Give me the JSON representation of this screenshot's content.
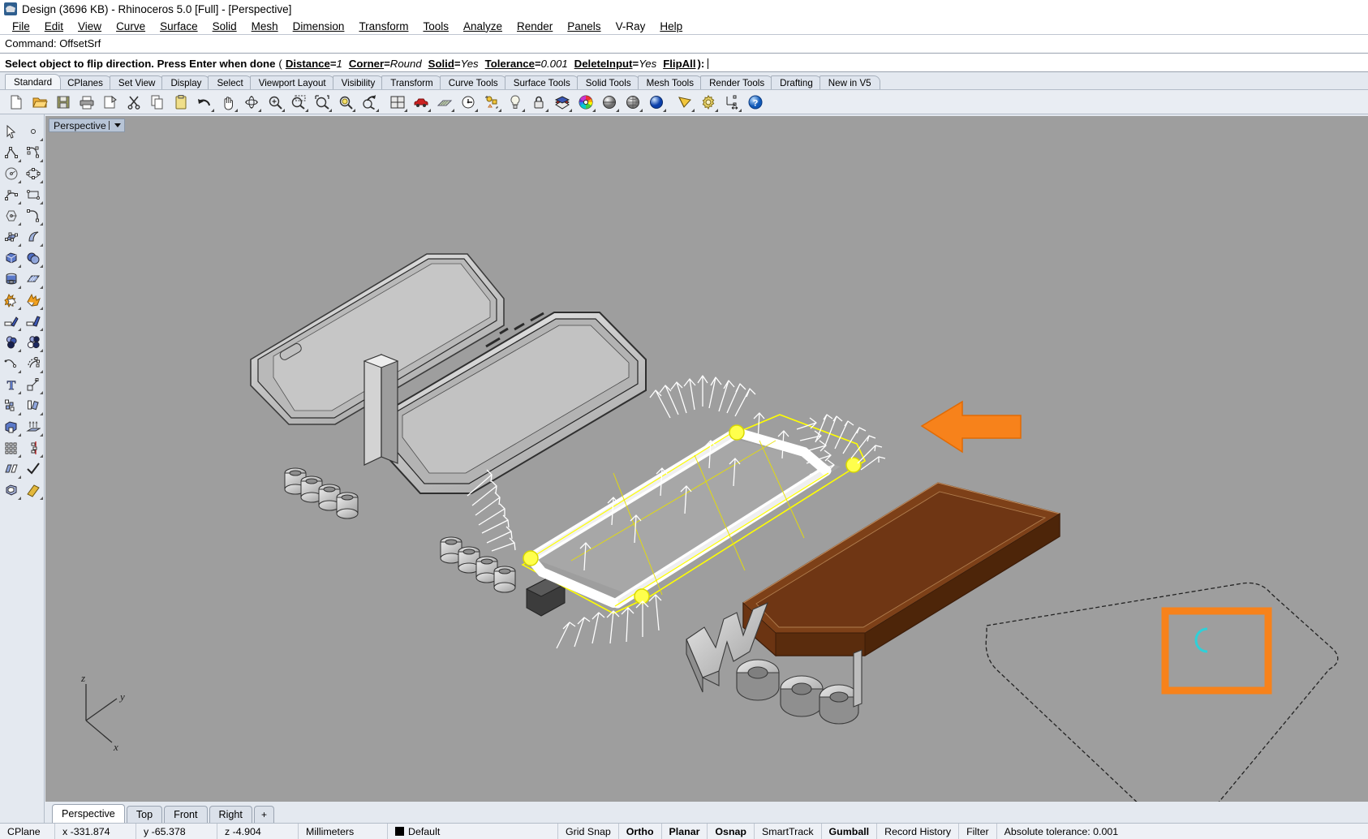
{
  "window": {
    "title": "Design (3696 KB) - Rhinoceros 5.0 [Full] - [Perspective]",
    "app_icon": "rhino-logo-icon"
  },
  "menubar": {
    "items": [
      {
        "label": "File"
      },
      {
        "label": "Edit"
      },
      {
        "label": "View"
      },
      {
        "label": "Curve"
      },
      {
        "label": "Surface"
      },
      {
        "label": "Solid"
      },
      {
        "label": "Mesh"
      },
      {
        "label": "Dimension"
      },
      {
        "label": "Transform"
      },
      {
        "label": "Tools"
      },
      {
        "label": "Analyze"
      },
      {
        "label": "Render"
      },
      {
        "label": "Panels"
      },
      {
        "label": "V-Ray"
      },
      {
        "label": "Help"
      }
    ]
  },
  "command_area": {
    "history": "Command: OffsetSrf",
    "prompt_main": "Select object to flip direction. Press Enter when done",
    "prompt_open": "(",
    "prompt_close": "):",
    "options": [
      {
        "name": "Distance",
        "value": "1"
      },
      {
        "name": "Corner",
        "value": "Round"
      },
      {
        "name": "Solid",
        "value": "Yes"
      },
      {
        "name": "Tolerance",
        "value": "0.001"
      },
      {
        "name": "DeleteInput",
        "value": "Yes"
      },
      {
        "name": "FlipAll",
        "value": ""
      }
    ]
  },
  "toolbar_tabs": {
    "active": "Standard",
    "items": [
      {
        "label": "Standard"
      },
      {
        "label": "CPlanes"
      },
      {
        "label": "Set View"
      },
      {
        "label": "Display"
      },
      {
        "label": "Select"
      },
      {
        "label": "Viewport Layout"
      },
      {
        "label": "Visibility"
      },
      {
        "label": "Transform"
      },
      {
        "label": "Curve Tools"
      },
      {
        "label": "Surface Tools"
      },
      {
        "label": "Solid Tools"
      },
      {
        "label": "Mesh Tools"
      },
      {
        "label": "Render Tools"
      },
      {
        "label": "Drafting"
      },
      {
        "label": "New in V5"
      }
    ]
  },
  "top_toolbar": {
    "buttons": [
      {
        "icon": "new-file-icon",
        "tip": "New"
      },
      {
        "icon": "open-folder-icon",
        "tip": "Open"
      },
      {
        "icon": "save-disk-icon",
        "tip": "Save"
      },
      {
        "icon": "printer-icon",
        "tip": "Print"
      },
      {
        "icon": "copy-to-clipboard-icon",
        "tip": "Copy to clipboard"
      },
      {
        "icon": "scissors-cut-icon",
        "tip": "Cut"
      },
      {
        "icon": "copy-pages-icon",
        "tip": "Copy"
      },
      {
        "icon": "paste-clipboard-icon",
        "tip": "Paste"
      },
      {
        "icon": "undo-arrow-icon",
        "tip": "Undo"
      },
      {
        "icon": "pan-hand-icon",
        "tip": "Pan"
      },
      {
        "icon": "rotate-view-icon",
        "tip": "Rotate view"
      },
      {
        "icon": "zoom-in-magnifier-icon",
        "tip": "Zoom in"
      },
      {
        "icon": "zoom-window-icon",
        "tip": "Zoom window"
      },
      {
        "icon": "zoom-extents-icon",
        "tip": "Zoom extents"
      },
      {
        "icon": "zoom-selected-icon",
        "tip": "Zoom selected"
      },
      {
        "icon": "zoom-dynamic-icon",
        "tip": "Zoom dynamic"
      },
      {
        "icon": "four-viewport-layout-icon",
        "tip": "4 viewports"
      },
      {
        "icon": "red-car-icon",
        "tip": "Shaded viewport"
      },
      {
        "icon": "grid-plane-icon",
        "tip": "Grid"
      },
      {
        "icon": "clock-history-icon",
        "tip": "History"
      },
      {
        "icon": "object-properties-icon",
        "tip": "Properties"
      },
      {
        "icon": "light-bulb-icon",
        "tip": "Lights"
      },
      {
        "icon": "padlock-icon",
        "tip": "Lock object"
      },
      {
        "icon": "layers-icon",
        "tip": "Layers"
      },
      {
        "icon": "color-wheel-icon",
        "tip": "Color wheel"
      },
      {
        "icon": "sphere-gray-icon",
        "tip": "Shade"
      },
      {
        "icon": "sphere-mesh-icon",
        "tip": "Render mesh"
      },
      {
        "icon": "sphere-blue-icon",
        "tip": "Render"
      },
      {
        "icon": "yellow-cone-icon",
        "tip": "Render preview"
      },
      {
        "icon": "gear-options-icon",
        "tip": "Options"
      },
      {
        "icon": "dimension-icon",
        "tip": "Dimension"
      },
      {
        "icon": "help-question-icon",
        "tip": "Help"
      }
    ]
  },
  "left_toolbar": {
    "buttons": [
      {
        "icon": "select-arrow-icon"
      },
      {
        "icon": "point-object-icon"
      },
      {
        "icon": "polyline-icon"
      },
      {
        "icon": "control-point-curve-icon"
      },
      {
        "icon": "circle-icon"
      },
      {
        "icon": "ellipse-icon"
      },
      {
        "icon": "arc-icon"
      },
      {
        "icon": "rectangle-icon"
      },
      {
        "icon": "polygon-icon"
      },
      {
        "icon": "curve-fillet-icon"
      },
      {
        "icon": "surface-control-points-icon"
      },
      {
        "icon": "surface-sweep-icon"
      },
      {
        "icon": "box-solid-icon"
      },
      {
        "icon": "sphere-solid-icon"
      },
      {
        "icon": "cylinder-solid-icon"
      },
      {
        "icon": "mesh-plane-icon"
      },
      {
        "icon": "boolean-union-icon"
      },
      {
        "icon": "explode-icon"
      },
      {
        "icon": "trim-icon"
      },
      {
        "icon": "split-icon"
      },
      {
        "icon": "boolean-spheres-icon"
      },
      {
        "icon": "boolean-difference-icon"
      },
      {
        "icon": "offset-curve-icon"
      },
      {
        "icon": "fillet-curve-icon"
      },
      {
        "icon": "text-object-icon"
      },
      {
        "icon": "scale-icon"
      },
      {
        "icon": "array-objects-icon"
      },
      {
        "icon": "move-object-icon"
      },
      {
        "icon": "cap-planar-holes-icon"
      },
      {
        "icon": "extrude-surface-icon"
      },
      {
        "icon": "rectangular-array-icon"
      },
      {
        "icon": "array-along-curve-icon"
      },
      {
        "icon": "flow-along-surface-icon"
      },
      {
        "icon": "checkmark-ok-icon"
      },
      {
        "icon": "shell-solid-icon"
      },
      {
        "icon": "wedge-icon"
      }
    ]
  },
  "viewport": {
    "label": "Perspective",
    "background_color": "#9e9e9e",
    "axis": {
      "x": "x",
      "y": "y",
      "z": "z"
    },
    "annotations": {
      "arrow_color": "#f7821b",
      "highlight_box_color": "#f7821b",
      "selected_object_color": "#ffff00",
      "direction_arrows_color": "#ffffff",
      "wood_text": "wood",
      "brown_slab_color": "#7b3f1a",
      "cyan_osnap_color": "#2fd0d8"
    },
    "tabs": {
      "active": "Perspective",
      "items": [
        {
          "label": "Perspective"
        },
        {
          "label": "Top"
        },
        {
          "label": "Front"
        },
        {
          "label": "Right"
        },
        {
          "label": "+"
        }
      ]
    }
  },
  "statusbar": {
    "cplane_label": "CPlane",
    "coords": [
      {
        "label": "x -331.874"
      },
      {
        "label": "y -65.378"
      },
      {
        "label": "z -4.904"
      }
    ],
    "units": "Millimeters",
    "layer": "Default",
    "layer_color": "#000000",
    "toggles": [
      {
        "label": "Grid Snap",
        "on": false
      },
      {
        "label": "Ortho",
        "on": true
      },
      {
        "label": "Planar",
        "on": true
      },
      {
        "label": "Osnap",
        "on": true
      },
      {
        "label": "SmartTrack",
        "on": false
      },
      {
        "label": "Gumball",
        "on": true
      },
      {
        "label": "Record History",
        "on": false
      },
      {
        "label": "Filter",
        "on": false
      }
    ],
    "tolerance": "Absolute tolerance: 0.001"
  }
}
